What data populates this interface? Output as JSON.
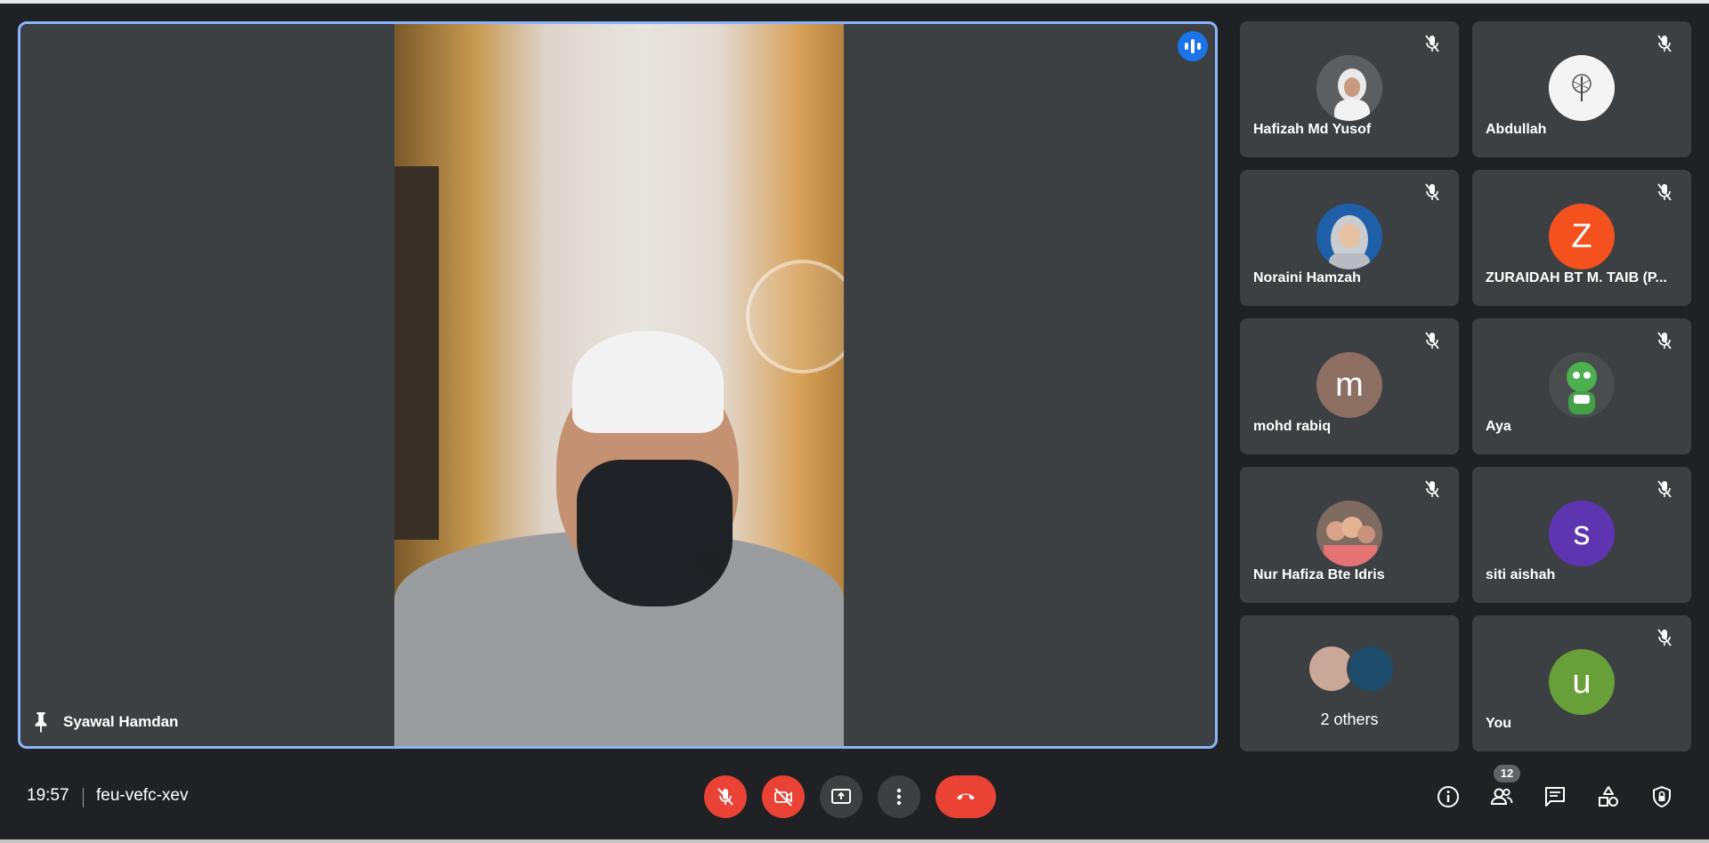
{
  "stage": {
    "name": "Syawal Hamdan",
    "pin_icon": "pin-icon",
    "speaking_icon": "speaking-indicator-icon"
  },
  "tiles": [
    {
      "name": "Hafizah Md Yusof",
      "avatar": "photo",
      "color": "#6b6f72",
      "muted": true
    },
    {
      "name": "Abdullah",
      "avatar": "photo",
      "color": "#f1f1f1",
      "muted": true
    },
    {
      "name": "Noraini Hamzah",
      "avatar": "photo",
      "color": "#1f5fa8",
      "muted": true
    },
    {
      "name": "ZURAIDAH BT M. TAIB (P...",
      "avatar": "Z",
      "color": "#f4511e",
      "muted": true
    },
    {
      "name": "mohd rabiq",
      "avatar": "m",
      "color": "#8d6e63",
      "muted": true
    },
    {
      "name": "Aya",
      "avatar": "photo",
      "color": "#4caf50",
      "muted": true
    },
    {
      "name": "Nur Hafiza Bte Idris",
      "avatar": "photo",
      "color": "#a1887f",
      "muted": true
    },
    {
      "name": "siti aishah",
      "avatar": "s",
      "color": "#5e35b1",
      "muted": true
    },
    {
      "name": "You",
      "avatar": "u",
      "color": "#689f38",
      "muted": true
    }
  ],
  "others": {
    "label": "2 others"
  },
  "bottom": {
    "time": "19:57",
    "meeting_code": "feu-vefc-xev",
    "people_count": "12"
  },
  "colors": {
    "accent": "#8ab4f8",
    "danger": "#ea4335",
    "tile_bg": "#3c4043",
    "page_bg": "#202124"
  }
}
